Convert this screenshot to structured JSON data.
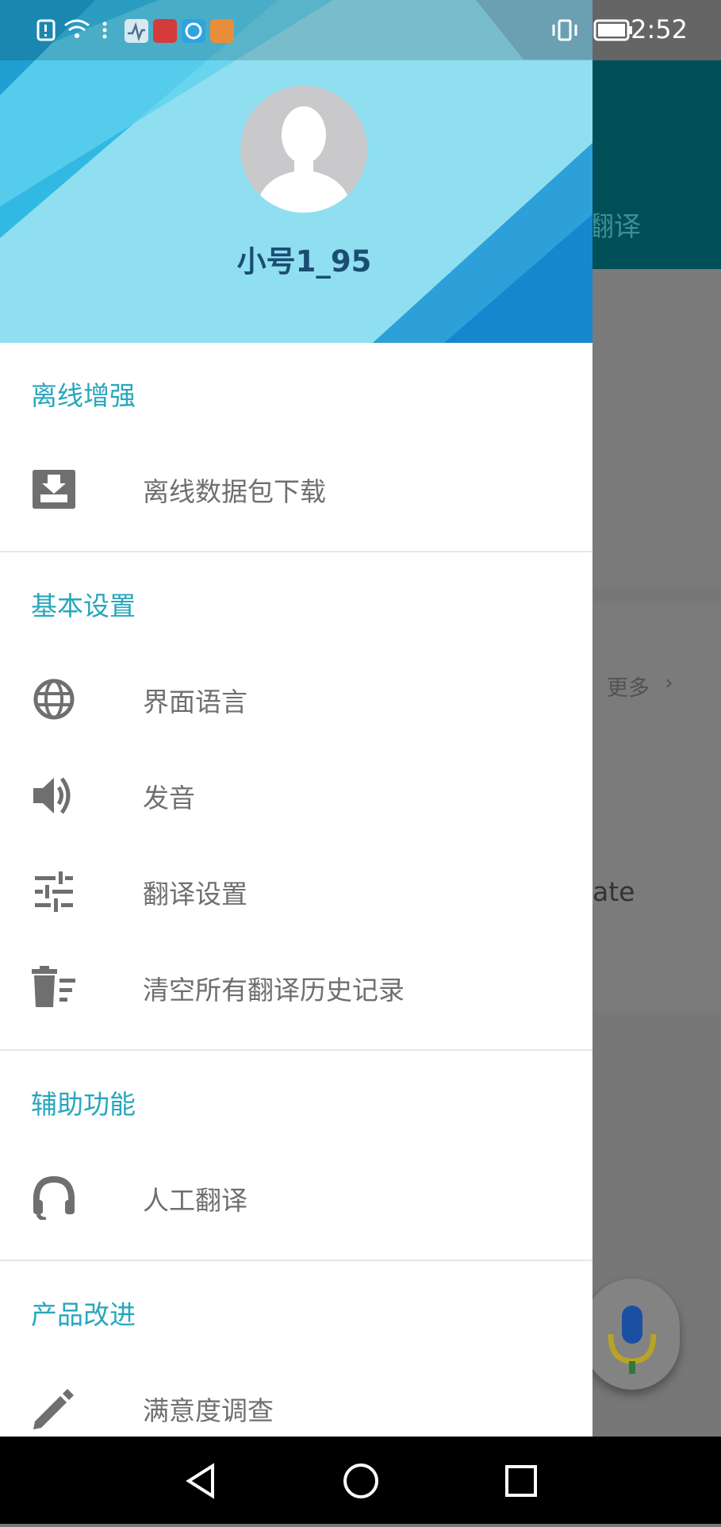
{
  "status_bar": {
    "time": "2:52"
  },
  "background_app": {
    "title_fragment": "翻译",
    "more_label": "更多",
    "more_chevron": "›",
    "partial_text": "ate"
  },
  "drawer": {
    "username": "小号1_95",
    "sections": [
      {
        "title": "离线增强",
        "items": [
          {
            "label": "离线数据包下载",
            "icon": "download-box-icon"
          }
        ]
      },
      {
        "title": "基本设置",
        "items": [
          {
            "label": "界面语言",
            "icon": "globe-icon"
          },
          {
            "label": "发音",
            "icon": "speaker-icon"
          },
          {
            "label": "翻译设置",
            "icon": "tune-sliders-icon"
          },
          {
            "label": "清空所有翻译历史记录",
            "icon": "clear-history-trash-icon"
          }
        ]
      },
      {
        "title": "辅助功能",
        "items": [
          {
            "label": "人工翻译",
            "icon": "headset-icon"
          }
        ]
      },
      {
        "title": "产品改进",
        "items": [
          {
            "label": "满意度调查",
            "icon": "pencil-icon"
          }
        ]
      }
    ]
  },
  "colors": {
    "accent": "#27a7bc",
    "header_bg": "#8fdff0",
    "toolbar": "#004f57"
  }
}
